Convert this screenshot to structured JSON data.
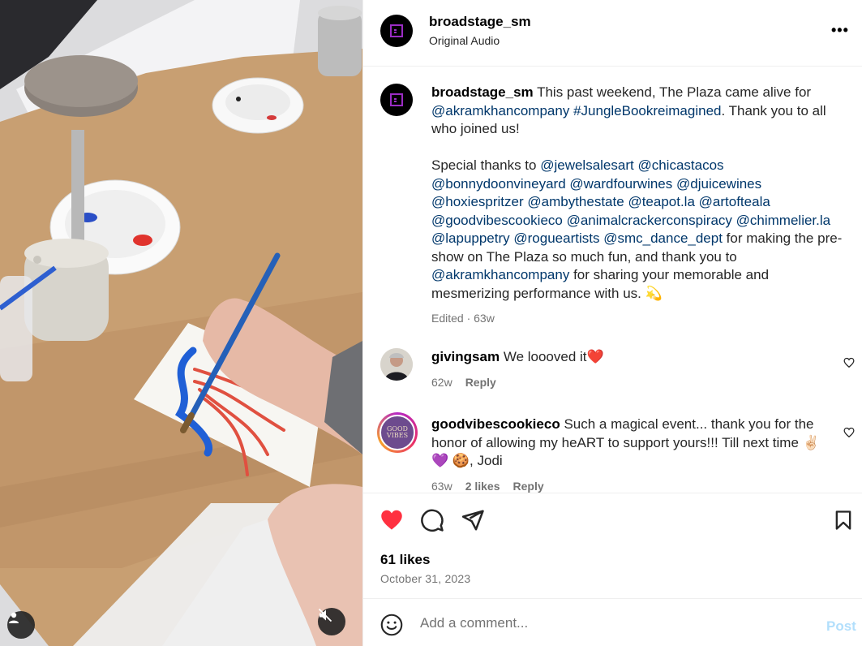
{
  "post": {
    "username": "broadstage_sm",
    "audio": "Original Audio",
    "caption": {
      "line1_pre": "This past weekend, The Plaza came alive for",
      "tag1": "@akramkhancompany",
      "tag2": "#JungleBookreimagined",
      "line2_post": ". Thank you to all who joined us!",
      "thanks_prefix": "Special thanks to",
      "mentions": [
        "@jewelsalesart",
        "@chicastacos",
        "@bonnydoonvineyard",
        "@wardfourwines",
        "@djuicewines",
        "@hoxiespritzer",
        "@ambythestate",
        "@teapot.la",
        "@artofteala",
        "@goodvibescookieco",
        "@animalcrackerconspiracy",
        "@chimmelier.la",
        "@lapuppetry",
        "@rogueartists",
        "@smc_dance_dept"
      ],
      "mid_text": "for making the pre-show on The Plaza so much fun, and thank you to",
      "tag3": "@akramkhancompany",
      "end_text": "for sharing your memorable and mesmerizing performance with us. 💫"
    },
    "caption_meta": "Edited · 63w"
  },
  "comments": [
    {
      "username": "givingsam",
      "text": "We loooved it❤️",
      "age": "62w",
      "reply_label": "Reply"
    },
    {
      "username": "goodvibescookieco",
      "text": "Such a magical event... thank you for the honor of allowing my heART to support yours!!! Till next time ✌🏻 💜 🍪, Jodi",
      "age": "63w",
      "likes": "2 likes",
      "reply_label": "Reply",
      "avatar_text": "GOOD VIBES"
    }
  ],
  "actions": {
    "likes": "61 likes",
    "date": "October 31, 2023",
    "comment_placeholder": "Add a comment...",
    "post_label": "Post"
  },
  "icons": {
    "like": "heart-filled-icon",
    "comment": "comment-bubble-icon",
    "share": "paper-plane-icon",
    "save": "bookmark-icon",
    "more": "more-horizontal-icon",
    "emoji": "emoji-smile-icon",
    "user": "user-tag-icon",
    "mute": "speaker-muted-icon"
  },
  "colors": {
    "heart": "#ff3040",
    "link": "#00376b",
    "secondary": "#737373",
    "brand_purple": "#9b2cc4",
    "post_disabled": "#b2dffc"
  }
}
